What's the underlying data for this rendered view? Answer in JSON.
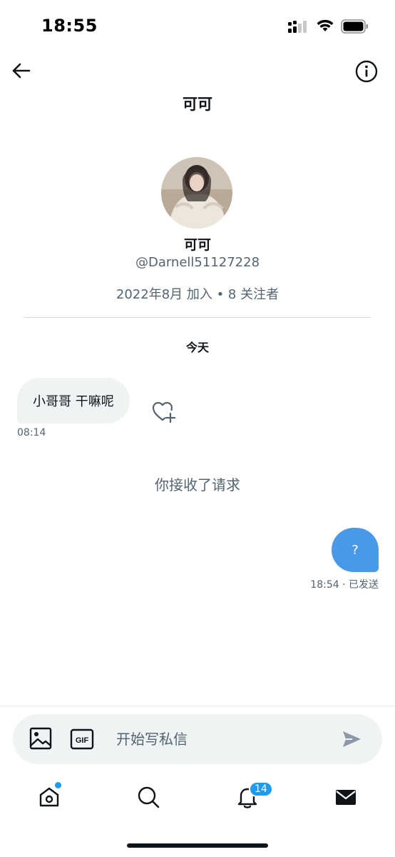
{
  "status_bar": {
    "time": "18:55"
  },
  "header": {
    "title": "可可"
  },
  "profile": {
    "name": "可可",
    "handle": "@Darnell51127228",
    "meta": "2022年8月 加入 • 8 关注者"
  },
  "conversation": {
    "day_label": "今天",
    "messages": [
      {
        "direction": "incoming",
        "text": "小哥哥 干嘛呢",
        "time": "08:14"
      },
      {
        "direction": "outgoing",
        "text": "?",
        "time_status": "18:54 · 已发送"
      }
    ],
    "system_note": "你接收了请求"
  },
  "composer": {
    "placeholder": "开始写私信"
  },
  "tab_bar": {
    "notifications_badge": "14",
    "home_has_dot": true
  },
  "colors": {
    "accent": "#1d9bf0",
    "outgoing_bubble": "#4a99e9",
    "incoming_bubble": "#eff3f4",
    "secondary_text": "#536471"
  }
}
